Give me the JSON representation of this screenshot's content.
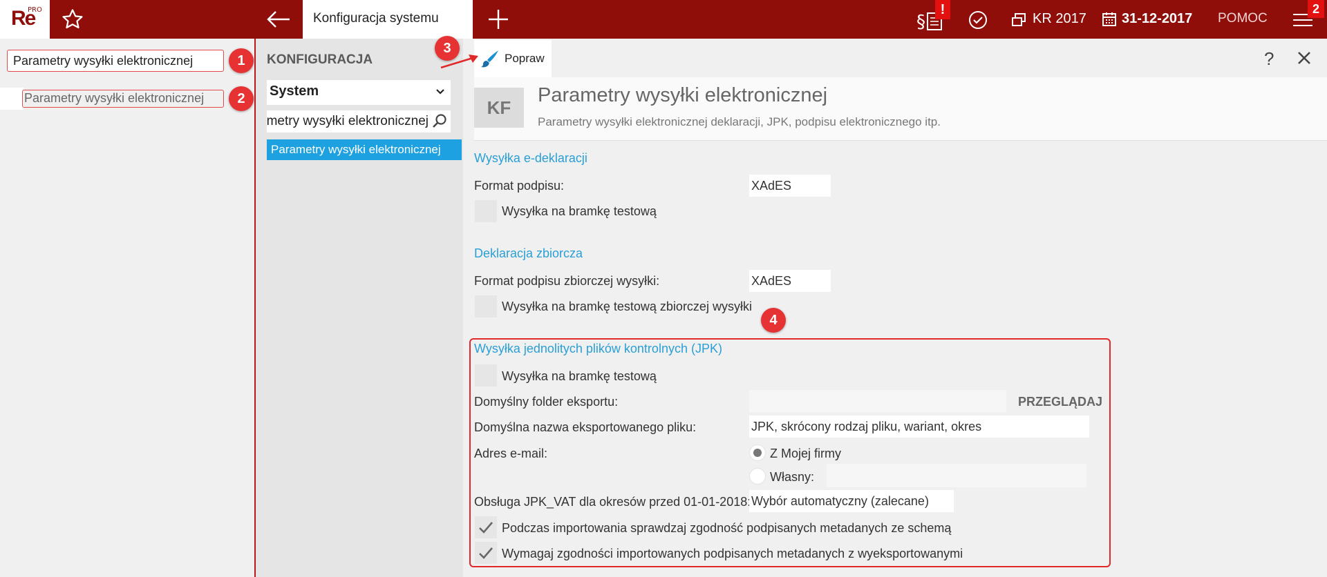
{
  "app": {
    "logo_text": "Re",
    "logo_sup": "PRO",
    "active_tab": "Konfiguracja systemu",
    "year": "KR 2017",
    "date": "31-12-2017",
    "help": "POMOC",
    "alert_badge": "!",
    "menu_badge": "2",
    "accent": "#8f0e0a"
  },
  "left": {
    "items": [
      {
        "label": "Parametry wysyłki elektronicznej"
      },
      {
        "label": "Parametry wysyłki elektronicznej"
      }
    ]
  },
  "callouts": [
    "1",
    "2",
    "3",
    "4"
  ],
  "middle": {
    "title": "KONFIGURACJA",
    "select_value": "System",
    "search_value": "Parametry wysyłki elektronicznej",
    "result": "Parametry wysyłki elektronicznej"
  },
  "main": {
    "toolbar_edit": "Popraw",
    "help_label": "?",
    "header_badge": "KF",
    "header_title": "Parametry wysyłki elektronicznej",
    "header_subtitle": "Parametry wysyłki elektronicznej deklaracji, JPK, podpisu elektronicznego itp.",
    "sections": {
      "edecl": {
        "title": "Wysyłka e-deklaracji",
        "format_label": "Format podpisu:",
        "format_value": "XAdES",
        "test_label": "Wysyłka na bramkę testową"
      },
      "collective": {
        "title": "Deklaracja zbiorcza",
        "format_label": "Format podpisu zbiorczej wysyłki:",
        "format_value": "XAdES",
        "test_label": "Wysyłka na bramkę testową zbiorczej wysyłki"
      },
      "jpk": {
        "title": "Wysyłka jednolitych plików kontrolnych (JPK)",
        "test_label": "Wysyłka na bramkę testową",
        "folder_label": "Domyślny folder eksportu:",
        "folder_value": "",
        "browse": "PRZEGLĄDAJ",
        "filename_label": "Domyślna nazwa eksportowanego pliku:",
        "filename_value": "JPK, skrócony rodzaj pliku, wariant, okres",
        "email_label": "Adres e-mail:",
        "email_option_company": "Z Mojej firmy",
        "email_option_own": "Własny:",
        "email_own_value": "",
        "vat_label": "Obsługa JPK_VAT dla okresów przed 01-01-2018:",
        "vat_value": "Wybór automatyczny (zalecane)",
        "check1": "Podczas importowania sprawdzaj zgodność podpisanych metadanych ze schemą",
        "check2": "Wymagaj zgodności importowanych podpisanych metadanych z wyeksportowanymi"
      }
    }
  },
  "icons": [
    "star-icon",
    "back-arrow-icon",
    "plus-icon",
    "law-document-icon",
    "check-circle-icon",
    "windows-icon",
    "calendar-icon",
    "hamburger-menu-icon",
    "chevron-down-icon",
    "search-icon",
    "brush-icon",
    "close-icon",
    "checkmark-icon"
  ]
}
